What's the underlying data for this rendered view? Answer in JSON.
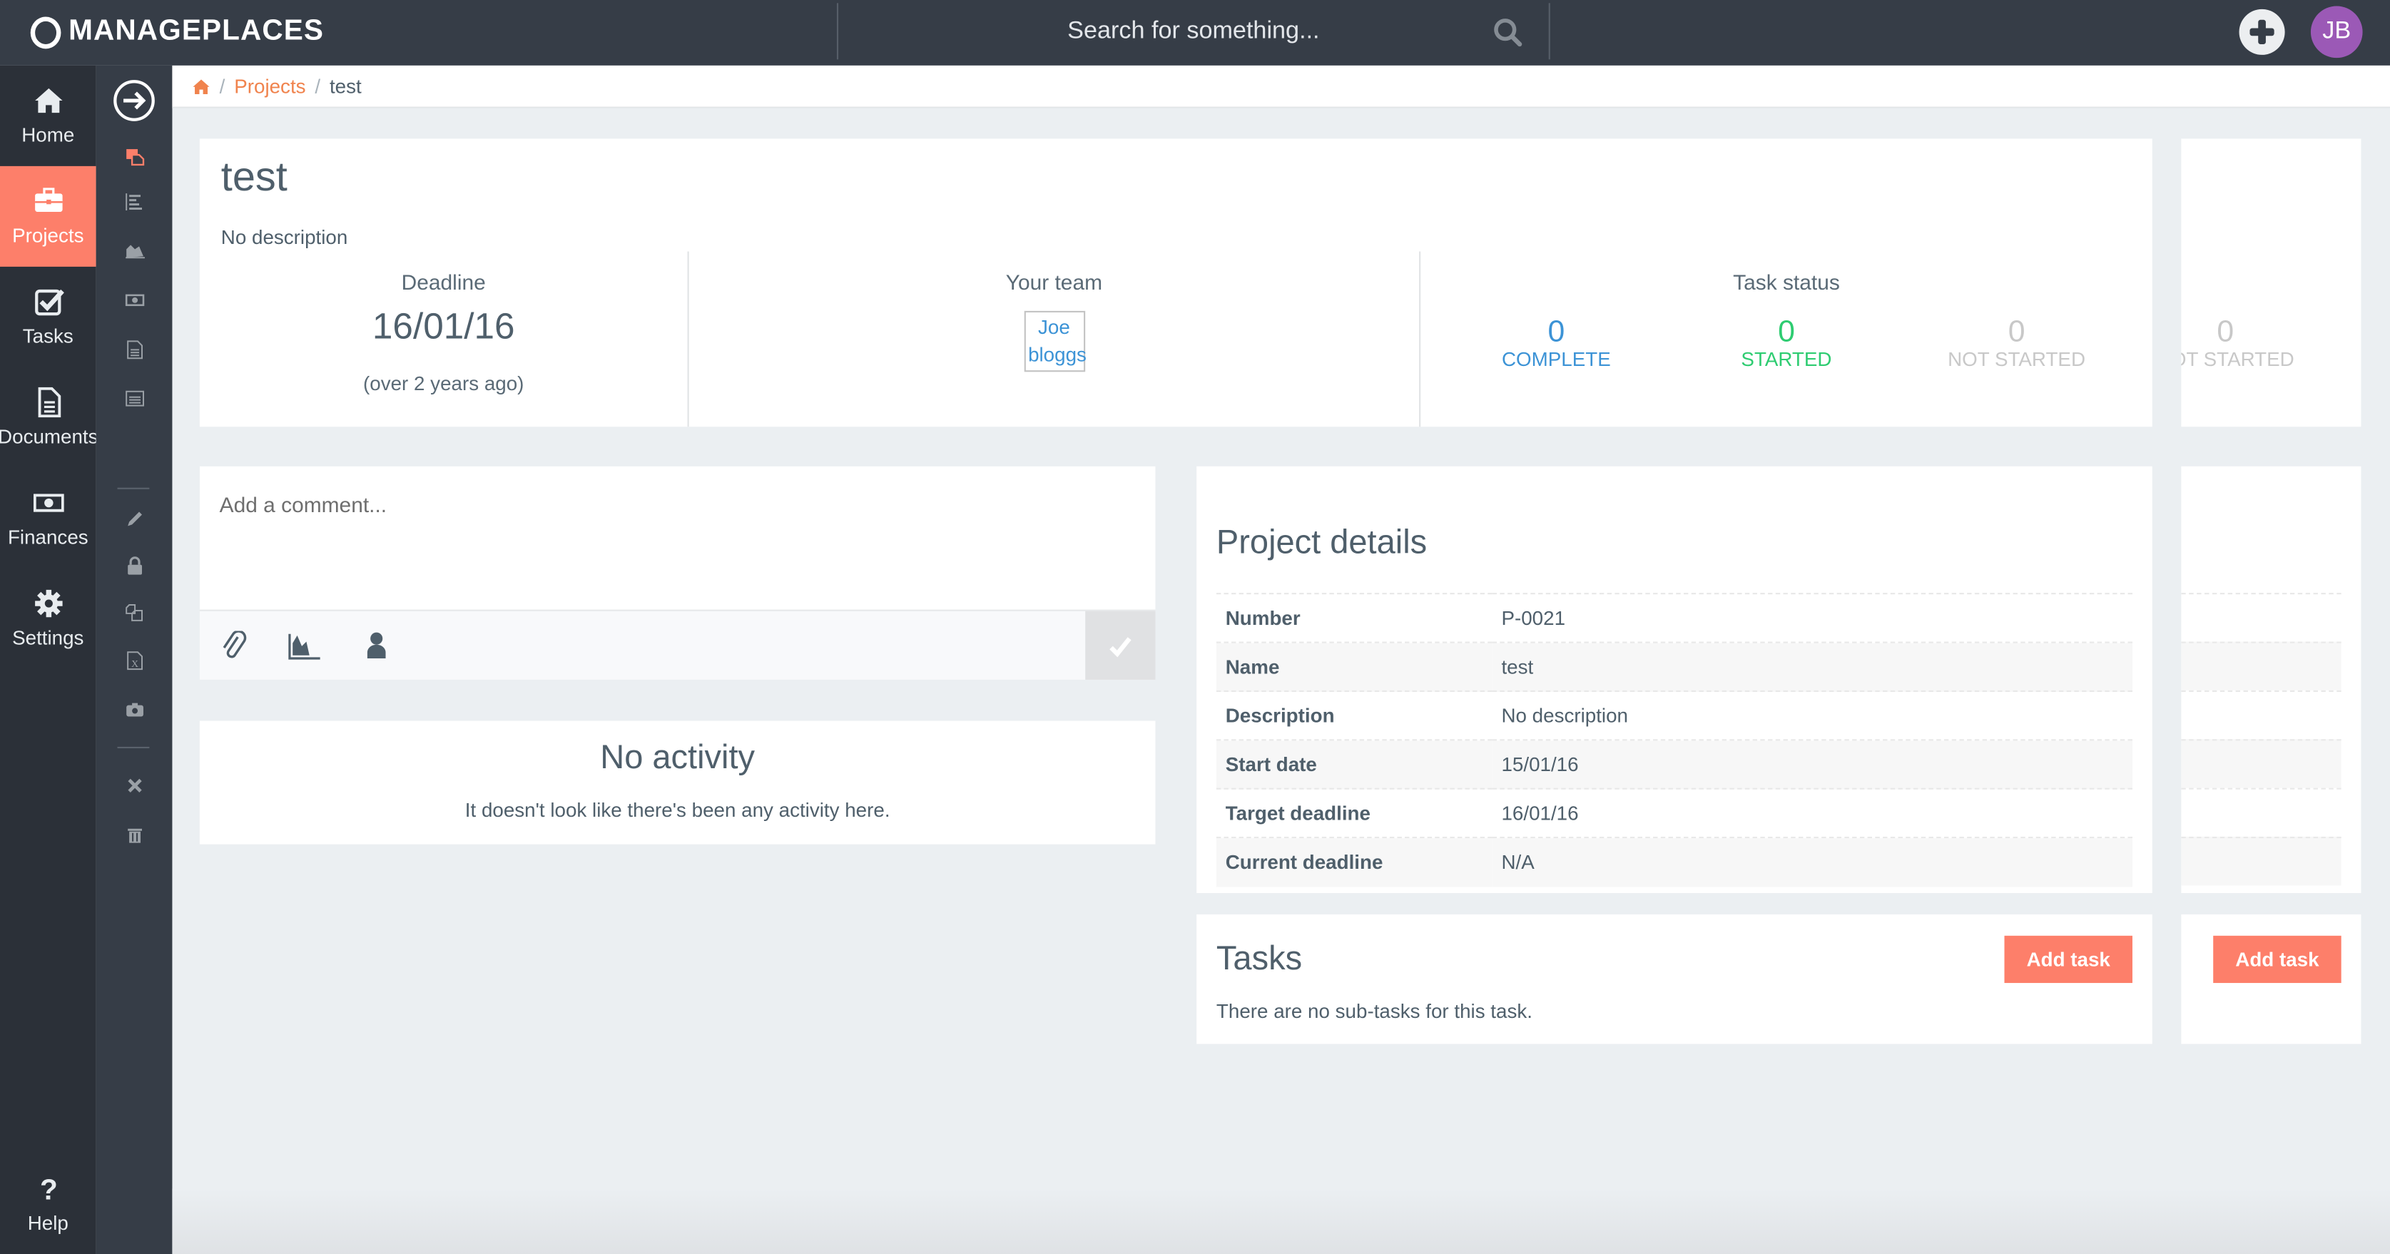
{
  "app": {
    "brand": "MANAGEPLACES",
    "search_placeholder": "Search for something...",
    "user_initials": "JB",
    "colors": {
      "accent": "#fd7f6a",
      "topbar": "#363d47",
      "sidebar": "#2b3038",
      "avatar": "#9b59b6",
      "complete": "#3c93d6",
      "started": "#2ecc71",
      "not_started": "#c8c8c8"
    }
  },
  "sidebar": {
    "items": [
      {
        "label": "Home",
        "icon": "home-icon",
        "active": false
      },
      {
        "label": "Projects",
        "icon": "briefcase-icon",
        "active": true
      },
      {
        "label": "Tasks",
        "icon": "check-square-icon",
        "active": false
      },
      {
        "label": "Documents",
        "icon": "document-icon",
        "active": false
      },
      {
        "label": "Finances",
        "icon": "money-icon",
        "active": false
      },
      {
        "label": "Settings",
        "icon": "gear-icon",
        "active": false
      }
    ],
    "help_label": "Help"
  },
  "subbar": {
    "icons": [
      "expand-arrow-icon",
      "projects-copy-icon",
      "gantt-icon",
      "area-chart-icon",
      "money-icon",
      "document-icon",
      "newspaper-icon",
      "pencil-icon",
      "lock-icon",
      "copy-icon",
      "excel-icon",
      "camera-icon",
      "close-icon",
      "trash-icon"
    ]
  },
  "breadcrumb": {
    "home_icon": "home-icon",
    "items": [
      "Projects",
      "test"
    ]
  },
  "project": {
    "title": "test",
    "description": "No description",
    "deadline_label": "Deadline",
    "deadline": "16/01/16",
    "deadline_relative": "(over 2 years ago)",
    "team_label": "Your team",
    "team_member": "Joe bloggs",
    "task_status_label": "Task status",
    "task_status": [
      {
        "count": "0",
        "label": "COMPLETE"
      },
      {
        "count": "0",
        "label": "STARTED"
      },
      {
        "count": "0",
        "label": "NOT STARTED"
      }
    ],
    "overflow_status": {
      "count": "0",
      "label": "NOT STARTED"
    }
  },
  "comment": {
    "placeholder": "Add a comment...",
    "tools": [
      "paperclip-icon",
      "area-chart-icon",
      "user-icon"
    ],
    "submit_icon": "check-icon"
  },
  "activity": {
    "title": "No activity",
    "message": "It doesn't look like there's been any activity here."
  },
  "details": {
    "title": "Project details",
    "rows": [
      {
        "key": "Number",
        "value": "P-0021"
      },
      {
        "key": "Name",
        "value": "test"
      },
      {
        "key": "Description",
        "value": "No description"
      },
      {
        "key": "Start date",
        "value": "15/01/16"
      },
      {
        "key": "Target deadline",
        "value": "16/01/16"
      },
      {
        "key": "Current deadline",
        "value": "N/A"
      }
    ]
  },
  "tasks": {
    "title": "Tasks",
    "add_label": "Add task",
    "empty_message": "There are no sub-tasks for this task."
  }
}
